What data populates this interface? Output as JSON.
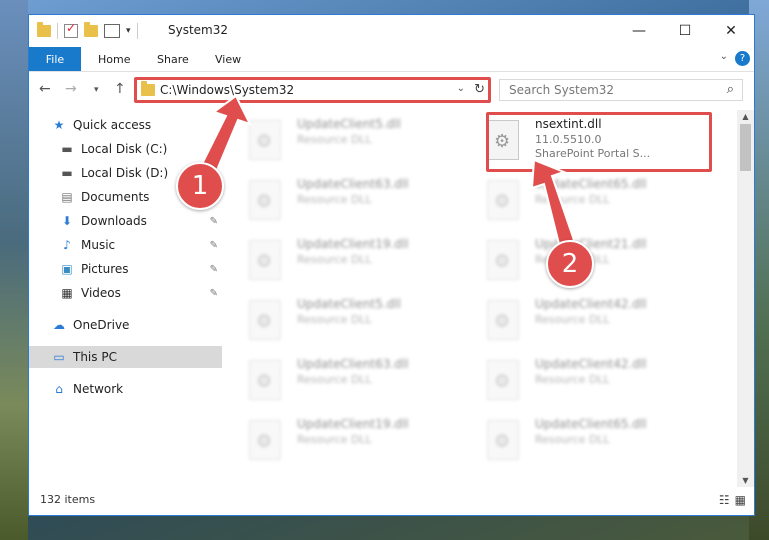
{
  "window": {
    "title": "System32"
  },
  "ribbon": {
    "file": "File",
    "tabs": [
      "Home",
      "Share",
      "View"
    ],
    "help": "?"
  },
  "address": {
    "path": "C:\\Windows\\System32"
  },
  "search": {
    "placeholder": "Search System32"
  },
  "sidebar": {
    "items": [
      {
        "label": "Quick access",
        "icon": "star-icon"
      },
      {
        "label": "Local Disk (C:)",
        "icon": "drive-icon"
      },
      {
        "label": "Local Disk (D:)",
        "icon": "drive-icon"
      },
      {
        "label": "Documents",
        "icon": "document-icon"
      },
      {
        "label": "Downloads",
        "icon": "download-icon"
      },
      {
        "label": "Music",
        "icon": "music-icon"
      },
      {
        "label": "Pictures",
        "icon": "pictures-icon"
      },
      {
        "label": "Videos",
        "icon": "video-icon"
      },
      {
        "label": "OneDrive",
        "icon": "cloud-icon"
      },
      {
        "label": "This PC",
        "icon": "computer-icon"
      },
      {
        "label": "Network",
        "icon": "network-icon"
      }
    ]
  },
  "files": {
    "highlighted": {
      "name": "nsextint.dll",
      "version": "11.0.5510.0",
      "description": "SharePoint Portal S..."
    },
    "left_column": [
      {
        "name": "UpdateClient5.dll",
        "type": "Resource DLL"
      },
      {
        "name": "UpdateClient63.dll",
        "type": "Resource DLL"
      },
      {
        "name": "UpdateClient19.dll",
        "type": "Resource DLL"
      },
      {
        "name": "UpdateClient5.dll",
        "type": "Resource DLL"
      },
      {
        "name": "UpdateClient63.dll",
        "type": "Resource DLL"
      },
      {
        "name": "UpdateClient19.dll",
        "type": "Resource DLL"
      }
    ],
    "right_column": [
      {
        "name": "UpdateClient65.dll",
        "type": "Resource DLL"
      },
      {
        "name": "UpdateClient21.dll",
        "type": "Resource DLL"
      },
      {
        "name": "UpdateClient42.dll",
        "type": "Resource DLL"
      },
      {
        "name": "UpdateClient42.dll",
        "type": "Resource DLL"
      },
      {
        "name": "UpdateClient65.dll",
        "type": "Resource DLL"
      }
    ]
  },
  "status": {
    "item_count": "132 items"
  },
  "callouts": {
    "one": "1",
    "two": "2"
  },
  "colors": {
    "accent": "#1979ca",
    "highlight": "#e04d4d"
  }
}
